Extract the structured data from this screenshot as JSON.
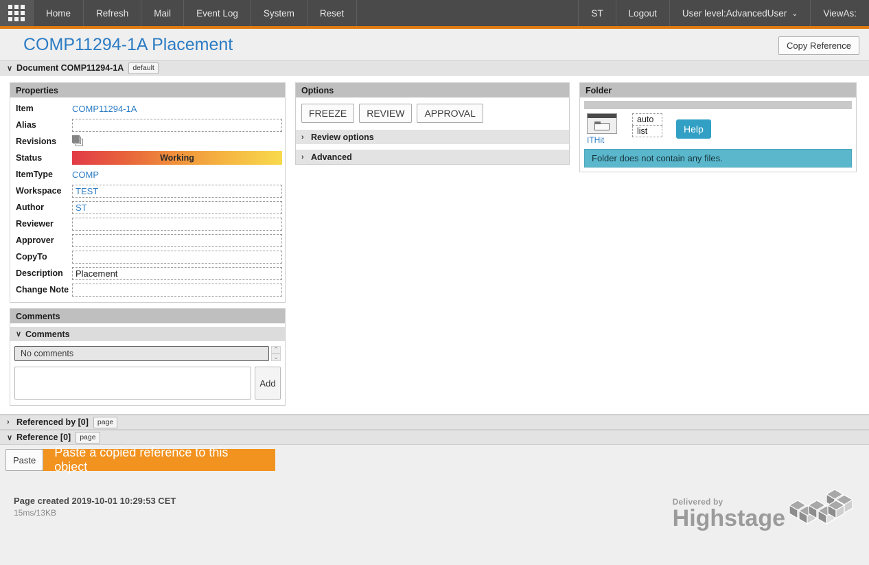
{
  "topnav": {
    "apps_icon": "grid-apps-icon",
    "items": [
      "Home",
      "Refresh",
      "Mail",
      "Event Log",
      "System",
      "Reset"
    ],
    "right_items": [
      "ST",
      "Logout"
    ],
    "user_level": "User level:AdvancedUser",
    "user_level_caret": "⌄",
    "view_as": "ViewAs:",
    "accent_color": "#e07b10",
    "bar_color": "#4a4a4a"
  },
  "header": {
    "page_title": "COMP11294-1A Placement",
    "copy_reference_label": "Copy Reference",
    "title_color": "#2b7cc4"
  },
  "document_section": {
    "caret": "∨",
    "label": "Document COMP11294-1A",
    "badge": "default"
  },
  "properties": {
    "heading": "Properties",
    "rows": [
      {
        "label": "Item",
        "value": "COMP11294-1A",
        "style": "link"
      },
      {
        "label": "Alias",
        "value": "",
        "style": "dashed"
      },
      {
        "label": "Revisions",
        "value": "",
        "style": "icon"
      },
      {
        "label": "Status",
        "value": "Working",
        "style": "status"
      },
      {
        "label": "ItemType",
        "value": "COMP",
        "style": "link"
      },
      {
        "label": "Workspace",
        "value": "TEST",
        "style": "dashed-link"
      },
      {
        "label": "Author",
        "value": "ST",
        "style": "dashed-link"
      },
      {
        "label": "Reviewer",
        "value": "",
        "style": "dashed"
      },
      {
        "label": "Approver",
        "value": "",
        "style": "dashed"
      },
      {
        "label": "CopyTo",
        "value": "",
        "style": "dashed"
      },
      {
        "label": "Description",
        "value": "Placement",
        "style": "dashed-text"
      },
      {
        "label": "Change Note",
        "value": "",
        "style": "dashed"
      }
    ],
    "status_gradient_from": "#e23b47",
    "status_gradient_to": "#f8da4c"
  },
  "comments": {
    "heading": "Comments",
    "sub_heading": "Comments",
    "sub_caret": "∨",
    "empty_text": "No comments",
    "textarea_value": "",
    "textarea_placeholder": "",
    "add_label": "Add",
    "scroll_up": "⌃",
    "scroll_down": "⌄"
  },
  "options": {
    "heading": "Options",
    "buttons": [
      "FREEZE",
      "REVIEW",
      "APPROVAL"
    ],
    "collapsed_sections": [
      {
        "caret": "›",
        "label": "Review options"
      },
      {
        "caret": "›",
        "label": "Advanced"
      }
    ]
  },
  "folder": {
    "heading": "Folder",
    "icon_name": "ithit-folder-icon",
    "icon_label": "ITHit",
    "mode_options": [
      "auto",
      "list"
    ],
    "help_label": "Help",
    "message": "Folder does not contain any files.",
    "message_color": "#5bb7cc"
  },
  "references": {
    "referenced_by": {
      "caret": "›",
      "label": "Referenced by [0]",
      "badge": "page"
    },
    "reference": {
      "caret": "∨",
      "label": "Reference [0]",
      "badge": "page"
    },
    "paste_label": "Paste",
    "paste_tip": "Paste a copied reference to this object",
    "tip_color": "#f29320"
  },
  "footer": {
    "created": "Page created 2019-10-01 10:29:53 CET",
    "perf": "15ms/13KB",
    "brand_delivered": "Delivered by",
    "brand_name": "Highstage"
  }
}
